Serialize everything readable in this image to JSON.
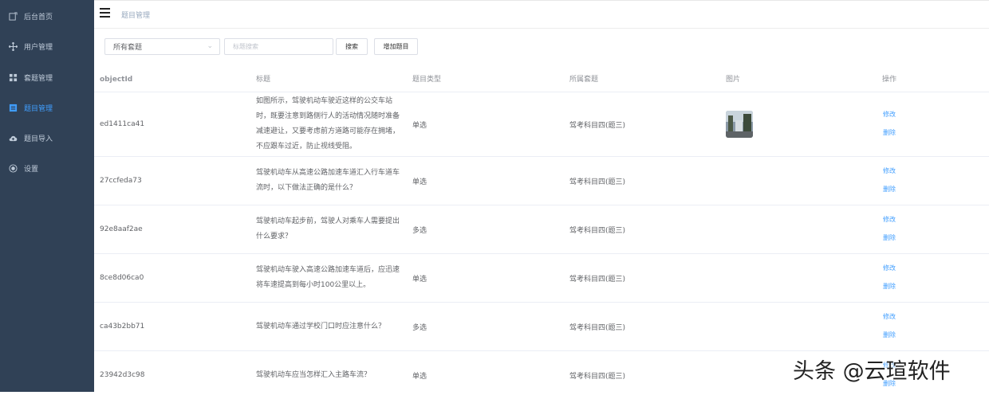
{
  "sidebar": {
    "items": [
      {
        "label": "后台首页",
        "icon": "dashboard-icon",
        "active": false
      },
      {
        "label": "用户管理",
        "icon": "move-icon",
        "active": false
      },
      {
        "label": "套题管理",
        "icon": "grid-icon",
        "active": false
      },
      {
        "label": "题目管理",
        "icon": "list-icon",
        "active": true
      },
      {
        "label": "题目导入",
        "icon": "cloud-upload-icon",
        "active": false
      },
      {
        "label": "设置",
        "icon": "settings-icon",
        "active": false
      }
    ]
  },
  "header": {
    "breadcrumb": "题目管理"
  },
  "toolbar": {
    "select_value": "所有套题",
    "search_placeholder": "标题搜索",
    "search_button": "搜索",
    "add_button": "增加题目"
  },
  "table": {
    "columns": [
      "objectId",
      "标题",
      "题目类型",
      "所属套题",
      "图片",
      "操作"
    ],
    "rows": [
      {
        "id": "ed1411ca41",
        "title": "如图所示，驾驶机动车驶近这样的公交车站时，既要注意到路侧行人的活动情况随时准备减速避让，又要考虑前方道路可能存在拥堵，不应跟车过近，防止视线受阻。",
        "type": "单选",
        "set": "驾考科目四(题三)",
        "has_image": true,
        "edit": "修改",
        "delete": "删除"
      },
      {
        "id": "27ccfeda73",
        "title": "驾驶机动车从高速公路加速车道汇入行车道车流时，以下做法正确的是什么？",
        "type": "单选",
        "set": "驾考科目四(题三)",
        "has_image": false,
        "edit": "修改",
        "delete": "删除"
      },
      {
        "id": "92e8aaf2ae",
        "title": "驾驶机动车起步前，驾驶人对乘车人需要提出什么要求？",
        "type": "多选",
        "set": "驾考科目四(题三)",
        "has_image": false,
        "edit": "修改",
        "delete": "删除"
      },
      {
        "id": "8ce8d06ca0",
        "title": "驾驶机动车驶入高速公路加速车道后，应迅速将车速提高到每小时100公里以上。",
        "type": "单选",
        "set": "驾考科目四(题三)",
        "has_image": false,
        "edit": "修改",
        "delete": "删除"
      },
      {
        "id": "ca43b2bb71",
        "title": "驾驶机动车通过学校门口时应注意什么？",
        "type": "多选",
        "set": "驾考科目四(题三)",
        "has_image": false,
        "edit": "修改",
        "delete": "删除"
      },
      {
        "id": "23942d3c98",
        "title": "驾驶机动车应当怎样汇入主路车流？",
        "type": "单选",
        "set": "驾考科目四(题三)",
        "has_image": false,
        "edit": "修改",
        "delete": "删除"
      }
    ]
  },
  "watermark": "头条 @云瑄软件",
  "colors": {
    "sidebar_bg": "#304156",
    "accent": "#409eff",
    "sidebar_text": "#bfcbd9"
  }
}
